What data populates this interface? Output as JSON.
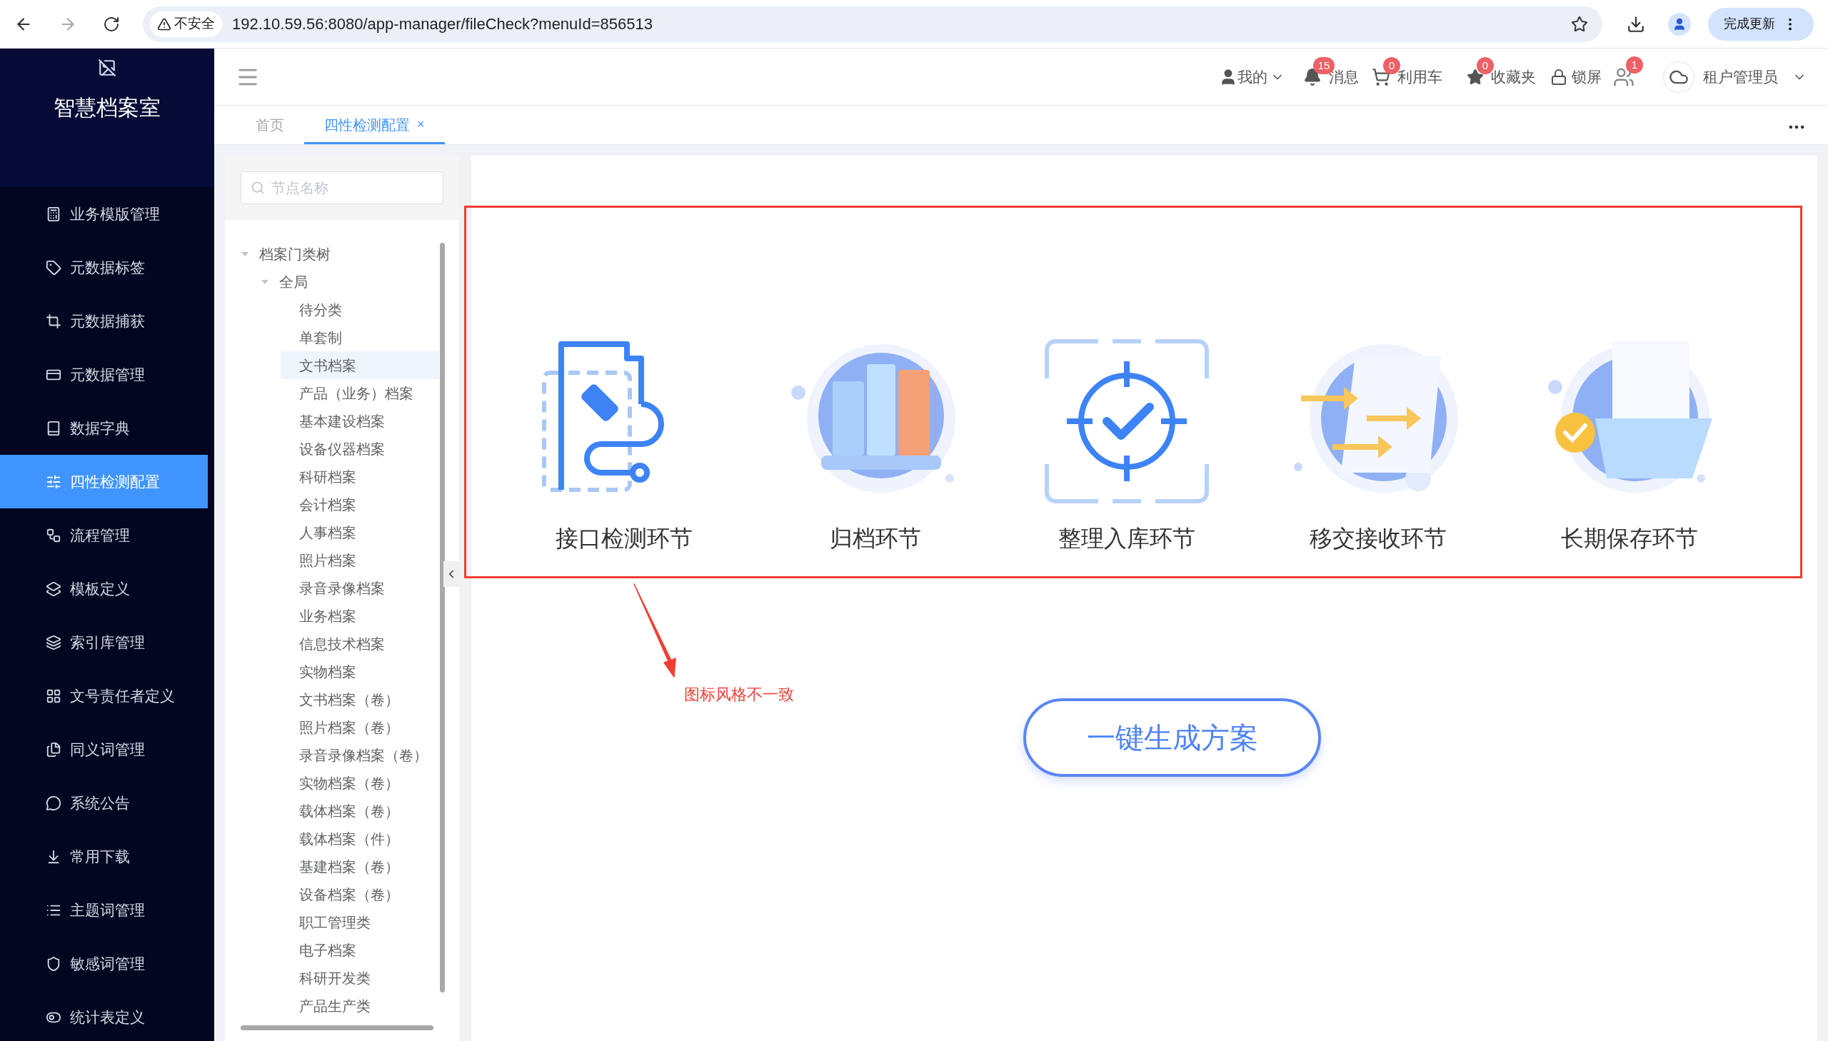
{
  "browser": {
    "security": "不安全",
    "url": "192.10.59.56:8080/app-manager/fileCheck?menuId=856513",
    "update_button": "完成更新"
  },
  "sidebar": {
    "title": "智慧档案室",
    "items": [
      {
        "label": "业务模版管理",
        "selected": false
      },
      {
        "label": "元数据标签",
        "selected": false
      },
      {
        "label": "元数据捕获",
        "selected": false
      },
      {
        "label": "元数据管理",
        "selected": false
      },
      {
        "label": "数据字典",
        "selected": false
      },
      {
        "label": "四性检测配置",
        "selected": true
      },
      {
        "label": "流程管理",
        "selected": false
      },
      {
        "label": "模板定义",
        "selected": false
      },
      {
        "label": "索引库管理",
        "selected": false
      },
      {
        "label": "文号责任者定义",
        "selected": false
      },
      {
        "label": "同义词管理",
        "selected": false
      },
      {
        "label": "系统公告",
        "selected": false
      },
      {
        "label": "常用下载",
        "selected": false
      },
      {
        "label": "主题词管理",
        "selected": false
      },
      {
        "label": "敏感词管理",
        "selected": false
      },
      {
        "label": "统计表定义",
        "selected": false
      }
    ]
  },
  "header": {
    "mine": "我的",
    "messages": {
      "label": "消息",
      "badge": "15"
    },
    "cart": {
      "label": "利用车",
      "badge": "0"
    },
    "favorites": {
      "label": "收藏夹",
      "badge": "0"
    },
    "lock": "锁屏",
    "users_badge": "1",
    "account": "租户管理员"
  },
  "tabs": [
    {
      "label": "首页",
      "selected": false
    },
    {
      "label": "四性检测配置",
      "selected": true,
      "close": "×"
    }
  ],
  "tree": {
    "search": {
      "placeholder": "节点名称"
    },
    "nodes": [
      {
        "label": "档案门类树",
        "expanded": true,
        "selected": false,
        "children": [
          {
            "label": "全局",
            "expanded": true,
            "selected": false,
            "children": [
              {
                "label": "待分类",
                "selected": false
              },
              {
                "label": "单套制",
                "selected": false
              },
              {
                "label": "文书档案",
                "selected": true
              },
              {
                "label": "产品（业务）档案",
                "selected": false
              },
              {
                "label": "基本建设档案",
                "selected": false
              },
              {
                "label": "设备仪器档案",
                "selected": false
              },
              {
                "label": "科研档案",
                "selected": false
              },
              {
                "label": "会计档案",
                "selected": false
              },
              {
                "label": "人事档案",
                "selected": false
              },
              {
                "label": "照片档案",
                "selected": false
              },
              {
                "label": "录音录像档案",
                "selected": false
              },
              {
                "label": "业务档案",
                "selected": false
              },
              {
                "label": "信息技术档案",
                "selected": false
              },
              {
                "label": "实物档案",
                "selected": false
              },
              {
                "label": "文书档案（卷）",
                "selected": false
              },
              {
                "label": "照片档案（卷）",
                "selected": false
              },
              {
                "label": "录音录像档案（卷）",
                "selected": false
              },
              {
                "label": "实物档案（卷）",
                "selected": false
              },
              {
                "label": "载体档案（卷）",
                "selected": false
              },
              {
                "label": "载体档案（件）",
                "selected": false
              },
              {
                "label": "基建档案（卷）",
                "selected": false
              },
              {
                "label": "设备档案（卷）",
                "selected": false
              },
              {
                "label": "职工管理类",
                "selected": false
              },
              {
                "label": "电子档案",
                "selected": false
              },
              {
                "label": "科研开发类",
                "selected": false
              },
              {
                "label": "产品生产类",
                "selected": false
              }
            ]
          }
        ]
      }
    ]
  },
  "stages": [
    {
      "label": "接口检测环节"
    },
    {
      "label": "归档环节"
    },
    {
      "label": "整理入库环节"
    },
    {
      "label": "移交接收环节"
    },
    {
      "label": "长期保存环节"
    }
  ],
  "generate_button": "一键生成方案",
  "annotation": {
    "text": "图标风格不一致"
  }
}
